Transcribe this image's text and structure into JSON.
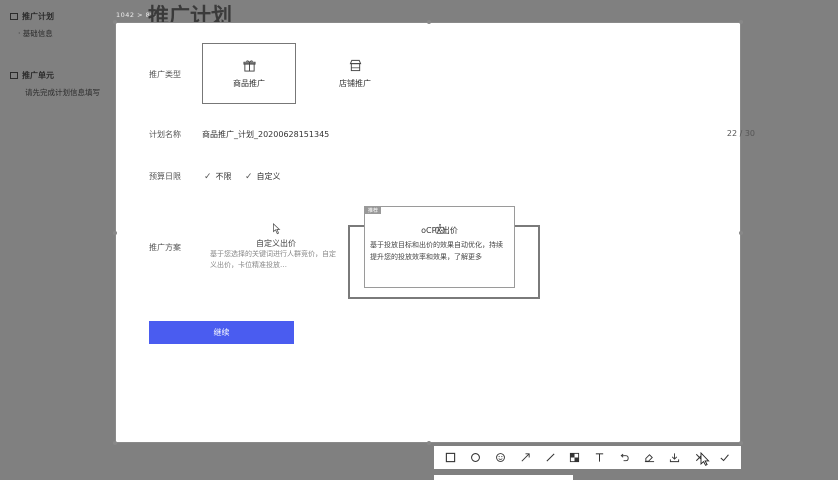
{
  "background": {
    "sidebar": {
      "section1": {
        "title": "推广计划",
        "sub": "基础信息"
      },
      "section2": {
        "title": "推广单元",
        "sub": "请先完成计划信息填写"
      }
    },
    "breadcrumb": "1042 > 8%",
    "page_title": "推广计划"
  },
  "form": {
    "type_label": "推广类型",
    "types": [
      {
        "label": "商品推广",
        "icon": "gift-icon",
        "selected": true
      },
      {
        "label": "店铺推广",
        "icon": "shop-icon",
        "selected": false
      }
    ],
    "name_label": "计划名称",
    "name_value": "商品推广_计划_20200628151345",
    "name_counter": "22 / 30",
    "budget_label": "预算日限",
    "budget_options": [
      {
        "label": "不限"
      },
      {
        "label": "自定义"
      }
    ],
    "method_label": "推广方案",
    "custom_bid": {
      "title": "自定义出价",
      "desc": "基于您选择的关键词进行人群竞价，自定义出价，卡位精准投放…"
    },
    "ocpx": {
      "tag": "推荐",
      "title": "oCPX出价",
      "desc": "基于投放目标和出价的效果自动优化，持续提升您的投放效率和效果，了解更多"
    },
    "continue_label": "继续"
  },
  "toolbar": {
    "tools": [
      "rect-icon",
      "ellipse-icon",
      "emoji-icon",
      "arrow-icon",
      "line-icon",
      "mosaic-icon",
      "text-icon",
      "undo-icon",
      "pin-icon",
      "download-icon",
      "close-icon",
      "confirm-icon"
    ]
  },
  "colors": {
    "overlay": "#808080",
    "primary": "#4a5cf0",
    "capture_bg": "#ffffff"
  }
}
